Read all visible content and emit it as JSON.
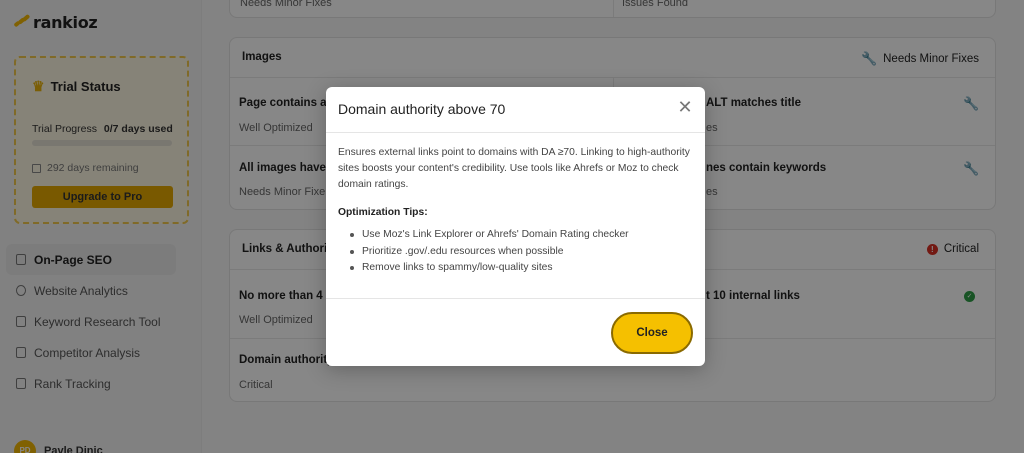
{
  "app": {
    "logo_text": "rankioz",
    "brand_color": "#f2b705"
  },
  "trial": {
    "title": "Trial Status",
    "progress_label": "Trial Progress",
    "progress_value": "0/7 days used",
    "progress_fraction": 0,
    "remaining": "292 days remaining",
    "upgrade_label": "Upgrade to Pro"
  },
  "nav": [
    {
      "label": "On-Page SEO",
      "icon": "document-icon",
      "active": true
    },
    {
      "label": "Website Analytics",
      "icon": "globe-icon"
    },
    {
      "label": "Keyword Research Tool",
      "icon": "pen-icon"
    },
    {
      "label": "Competitor Analysis",
      "icon": "monitor-icon"
    },
    {
      "label": "Rank Tracking",
      "icon": "chart-icon"
    }
  ],
  "user": {
    "initials": "PD",
    "name": "Pavle Dinic"
  },
  "top_card": {
    "left_sub": "Needs Minor Fixes",
    "right_sub": "Issues Found"
  },
  "images_card": {
    "title": "Images",
    "status": "Needs Minor Fixes",
    "cells": [
      {
        "title": "Page contains at",
        "sub": "Well Optimized"
      },
      {
        "title": "ALT matches title",
        "sub": "es"
      },
      {
        "title": "All images have A",
        "sub": "Needs Minor Fixe"
      },
      {
        "title": "nes contain keywords",
        "sub": "es"
      }
    ]
  },
  "links_card": {
    "title": "Links & Authorit",
    "status": "Critical",
    "cells": [
      {
        "title": "No more than 4 e",
        "sub": "Well Optimized"
      },
      {
        "title": "t 10 internal links",
        "sub": ""
      },
      {
        "title": "Domain authority",
        "sub": "Critical"
      }
    ]
  },
  "modal": {
    "title": "Domain authority above 70",
    "description": "Ensures external links point to domains with DA ≥70. Linking to high-authority sites boosts your content's credibility. Use tools like Ahrefs or Moz to check domain ratings.",
    "tips_title": "Optimization Tips:",
    "tips": [
      "Use Moz's Link Explorer or Ahrefs' Domain Rating checker",
      "Prioritize .gov/.edu resources when possible",
      "Remove links to spammy/low-quality sites"
    ],
    "close_label": "Close"
  }
}
